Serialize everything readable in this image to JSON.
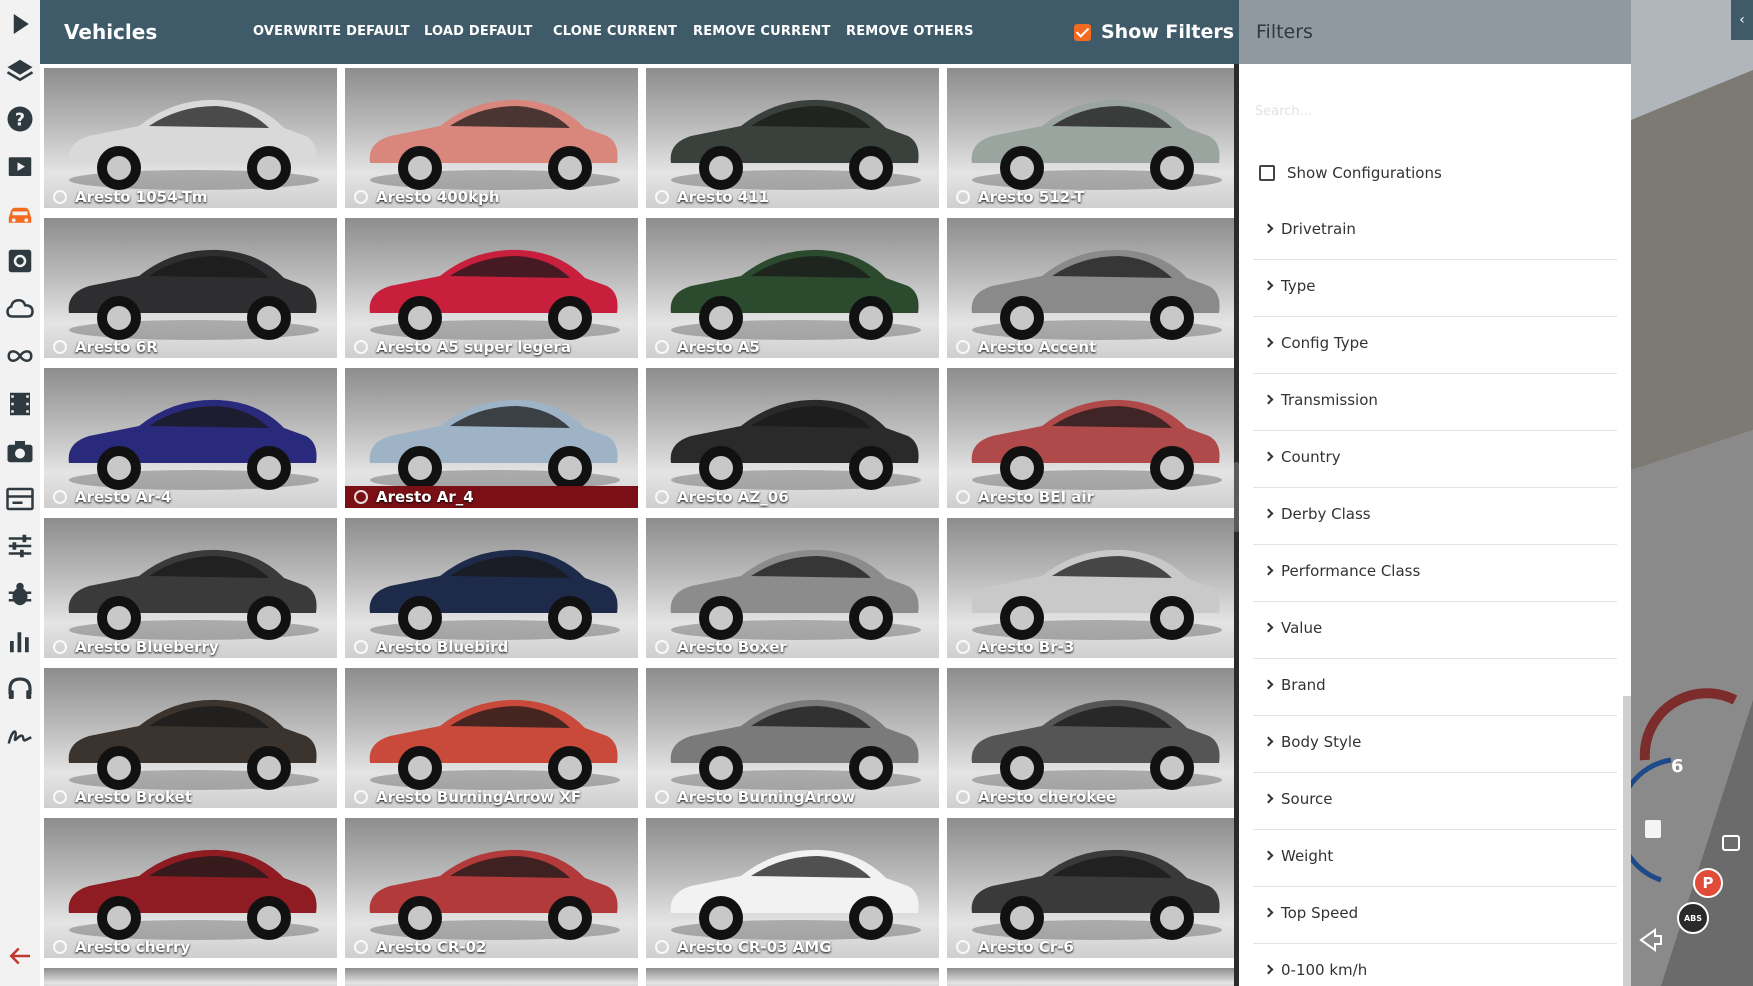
{
  "header": {
    "title": "Vehicles",
    "buttons": [
      "OVERWRITE DEFAULT",
      "LOAD DEFAULT",
      "CLONE CURRENT",
      "REMOVE CURRENT",
      "REMOVE OTHERS"
    ],
    "show_filters_label": "Show Filters",
    "show_filters_checked": true
  },
  "sidebar": {
    "icons": [
      "play-icon",
      "layers-icon",
      "help-icon",
      "video-icon",
      "car-icon",
      "settings-icon",
      "cloud-icon",
      "infinity-icon",
      "film-icon",
      "camera-icon",
      "panel-icon",
      "sliders-icon",
      "bug-icon",
      "bar-chart-icon",
      "headphones-icon",
      "signature-icon",
      "back-arrow-icon"
    ],
    "active_icon": "car-icon",
    "accent": "#f26b21"
  },
  "vehicles": [
    {
      "name": "Aresto 1054-Tm",
      "color": "#d9d9d9"
    },
    {
      "name": "Aresto 400kph",
      "color": "#d9877c"
    },
    {
      "name": "Aresto 411",
      "color": "#3a403b"
    },
    {
      "name": "Aresto 512-T",
      "color": "#9aa5a0"
    },
    {
      "name": "Aresto 6R",
      "color": "#2e2e30"
    },
    {
      "name": "Aresto A5 super legera",
      "color": "#c81f3c"
    },
    {
      "name": "Aresto A5",
      "color": "#2b4a2e"
    },
    {
      "name": "Aresto Accent",
      "color": "#8a8a8a"
    },
    {
      "name": "Aresto Ar-4",
      "color": "#2a2a7c"
    },
    {
      "name": "Aresto Ar_4",
      "color": "#9fb3c7",
      "selected": true
    },
    {
      "name": "Aresto AZ_06",
      "color": "#2a2a2a"
    },
    {
      "name": "Aresto BEI air",
      "color": "#b04a4a"
    },
    {
      "name": "Aresto Blueberry",
      "color": "#3a3a3a"
    },
    {
      "name": "Aresto Bluebird",
      "color": "#1d2a4a"
    },
    {
      "name": "Aresto Boxer",
      "color": "#8c8c8c"
    },
    {
      "name": "Aresto Br-3",
      "color": "#c9c9c9"
    },
    {
      "name": "Aresto Broket",
      "color": "#3b342e"
    },
    {
      "name": "Aresto BurningArrow XF",
      "color": "#c94a3a"
    },
    {
      "name": "Aresto BurningArrow",
      "color": "#7a7a7a"
    },
    {
      "name": "Aresto cherokee",
      "color": "#555555"
    },
    {
      "name": "Aresto cherry",
      "color": "#8e1c22"
    },
    {
      "name": "Aresto CR-02",
      "color": "#b23a3a"
    },
    {
      "name": "Aresto CR-03 AMG",
      "color": "#f2f2f2"
    },
    {
      "name": "Aresto Cr-6",
      "color": "#3a3a3a"
    }
  ],
  "filters": {
    "title": "Filters",
    "search_placeholder": "Search...",
    "show_configurations": "Show Configurations",
    "categories": [
      "Drivetrain",
      "Type",
      "Config Type",
      "Transmission",
      "Country",
      "Derby Class",
      "Performance Class",
      "Value",
      "Brand",
      "Body Style",
      "Source",
      "Weight",
      "Top Speed",
      "0-100 km/h"
    ]
  },
  "hud": {
    "gear": "6",
    "parking_label": "P",
    "abs_label": "ABS"
  }
}
